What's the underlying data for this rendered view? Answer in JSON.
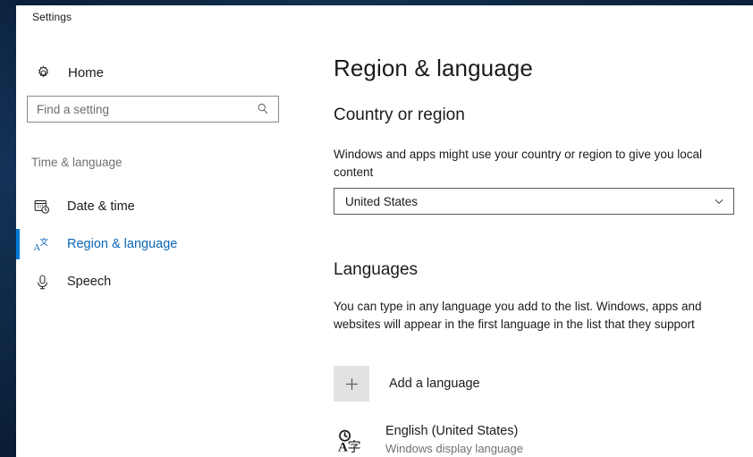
{
  "window": {
    "title": "Settings"
  },
  "sidebar": {
    "home": {
      "label": "Home",
      "icon": "gear-icon"
    },
    "search": {
      "placeholder": "Find a setting",
      "value": "",
      "icon": "search-icon"
    },
    "group_header": "Time & language",
    "items": [
      {
        "label": "Date & time",
        "icon": "calendar-clock-icon",
        "selected": false
      },
      {
        "label": "Region & language",
        "icon": "language-icon",
        "selected": true
      },
      {
        "label": "Speech",
        "icon": "microphone-icon",
        "selected": false
      }
    ]
  },
  "main": {
    "page_title": "Region & language",
    "country_section": {
      "title": "Country or region",
      "description": "Windows and apps might use your country or region to give you local content",
      "dropdown": {
        "value": "United States",
        "icon": "chevron-down-icon"
      }
    },
    "languages_section": {
      "title": "Languages",
      "description": "You can type in any language you add to the list. Windows, apps and websites will appear in the first language in the list that they support",
      "add_language": {
        "label": "Add a language",
        "icon": "plus-icon"
      },
      "installed": [
        {
          "name": "English (United States)",
          "subtitle": "Windows display language",
          "icon": "language-pack-icon"
        }
      ]
    }
  },
  "colors": {
    "accent": "#0078d7",
    "selected_text": "#0b66b6",
    "text": "#1b1b1b",
    "muted_text": "#707070",
    "desktop": "#12304f",
    "plus_box": "#e2e2e2"
  }
}
